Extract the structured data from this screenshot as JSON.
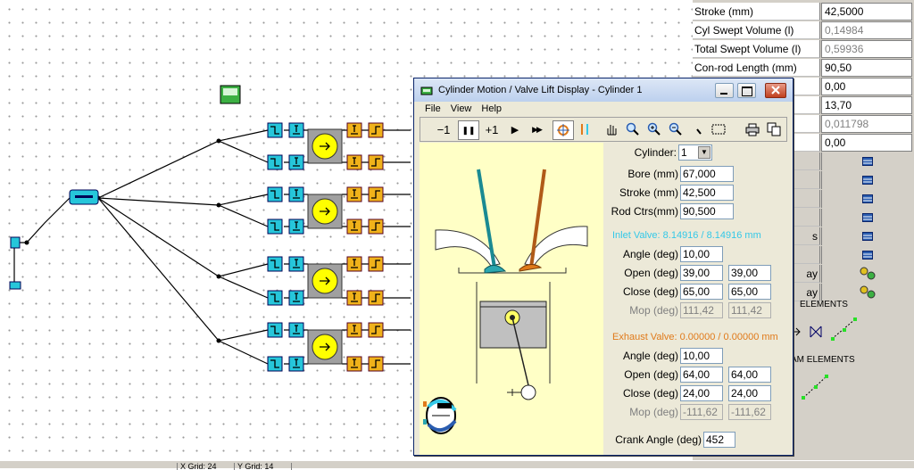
{
  "window_title": "Cylinder Motion / Valve Lift Display - Cylinder 1",
  "menu": [
    "File",
    "View",
    "Help"
  ],
  "toolbar": {
    "step_back": "−1",
    "pause": "❚❚",
    "step_fwd": "+1",
    "play": "▶",
    "fast_fwd": "▶▶"
  },
  "cylinder": {
    "label": "Cylinder:",
    "value": "1"
  },
  "bore": {
    "label": "Bore (mm)",
    "value": "67,000"
  },
  "stroke": {
    "label": "Stroke (mm)",
    "value": "42,500"
  },
  "rod": {
    "label": "Rod Ctrs(mm)",
    "value": "90,500"
  },
  "inlet": {
    "title": "Inlet Valve: 8.14916 / 8.14916 mm",
    "color": "#33c8e8",
    "angle": {
      "label": "Angle (deg)",
      "value": "10,00"
    },
    "open": {
      "label": "Open (deg)",
      "v1": "39,00",
      "v2": "39,00"
    },
    "close": {
      "label": "Close (deg)",
      "v1": "65,00",
      "v2": "65,00"
    },
    "mop": {
      "label": "Mop (deg)",
      "v1": "111,42",
      "v2": "111,42"
    }
  },
  "exhaust": {
    "title": "Exhaust Valve: 0.00000 / 0.00000 mm",
    "color": "#e07a1a",
    "angle": {
      "label": "Angle (deg)",
      "value": "10,00"
    },
    "open": {
      "label": "Open (deg)",
      "v1": "64,00",
      "v2": "64,00"
    },
    "close": {
      "label": "Close (deg)",
      "v1": "24,00",
      "v2": "24,00"
    },
    "mop": {
      "label": "Mop (deg)",
      "v1": "-111,62",
      "v2": "-111,62"
    }
  },
  "crank": {
    "label": "Crank Angle (deg)",
    "value": "452"
  },
  "props": [
    {
      "label": "Stroke (mm)",
      "value": "42,5000"
    },
    {
      "label": "Cyl Swept Volume (l)",
      "value": "0,14984"
    },
    {
      "label": "Total Swept Volume (l)",
      "value": "0,59936"
    },
    {
      "label": "Con-rod Length (mm)",
      "value": "90,50"
    },
    {
      "label": "",
      "value": "0,00"
    },
    {
      "label": "",
      "value": "13,70"
    },
    {
      "label": "",
      "value": "0,011798"
    },
    {
      "label": "",
      "value": "0,00"
    }
  ],
  "props_side_text": {
    "s": "s",
    "ay1": "ay",
    "ay2": "ay"
  },
  "elements_labels": {
    "e1": "ELEMENTS",
    "e2": "AM ELEMENTS"
  },
  "status": {
    "c1": "X Grid: 24",
    "c2": "Y Grid: 14"
  }
}
